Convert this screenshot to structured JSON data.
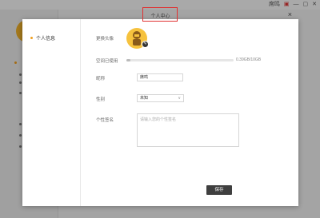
{
  "app": {
    "user_label": "席鸣"
  },
  "modal": {
    "title": "个人中心",
    "close_glyph": "×"
  },
  "nav": {
    "items": [
      {
        "label": "个人信息"
      }
    ]
  },
  "profile": {
    "avatar_label": "更换头像",
    "storage_label": "空间已使用",
    "storage_text": "0.39GB/10GB",
    "storage_used_fraction": 0.039,
    "nickname_label": "昵称",
    "nickname_value": "席鸣",
    "gender_label": "性别",
    "gender_value": "未知",
    "signature_label": "个性签名",
    "signature_placeholder": "请输入您的个性签名",
    "save_label": "保存"
  },
  "colors": {
    "accent": "#f0a020",
    "avatar": "#f6c23e",
    "highlight_box": "#e03030",
    "save_button": "#3f3f3f"
  }
}
